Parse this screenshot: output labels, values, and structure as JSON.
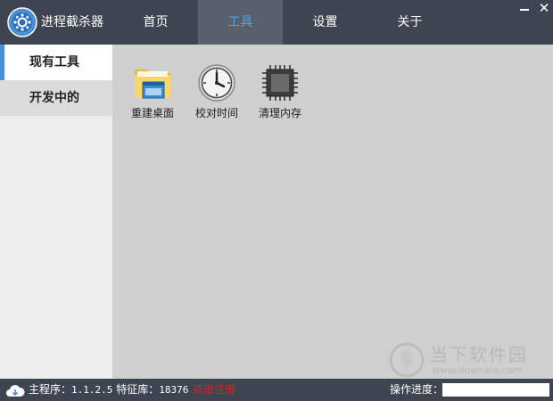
{
  "app": {
    "title": "进程截杀器"
  },
  "nav": {
    "tabs": [
      {
        "label": "首页",
        "active": false
      },
      {
        "label": "工具",
        "active": true
      },
      {
        "label": "设置",
        "active": false
      },
      {
        "label": "关于",
        "active": false
      }
    ]
  },
  "window_controls": {
    "minimize": "—",
    "close": "✕"
  },
  "sidebar": {
    "items": [
      {
        "label": "现有工具",
        "active": true
      },
      {
        "label": "开发中的",
        "active": false
      }
    ]
  },
  "tools": [
    {
      "label": "重建桌面",
      "icon": "folder-window-icon"
    },
    {
      "label": "校对时间",
      "icon": "clock-icon"
    },
    {
      "label": "清理内存",
      "icon": "chip-icon"
    }
  ],
  "watermark": {
    "name": "当下软件园",
    "url": "www.downxia.com"
  },
  "status": {
    "main_label": "主程序：",
    "main_version": "1.1.2.5",
    "lib_label": "特征库：",
    "lib_version": "18376",
    "register_text": "点击注册",
    "progress_label": "操作进度：",
    "progress": 0
  },
  "colors": {
    "header_bg": "#3f4550",
    "active_tab_bg": "#5a606b",
    "active_tab_text": "#4fa3e8",
    "sidebar_accent": "#4a90d9",
    "content_bg": "#cfcfcf",
    "register_red": "#e02020"
  }
}
